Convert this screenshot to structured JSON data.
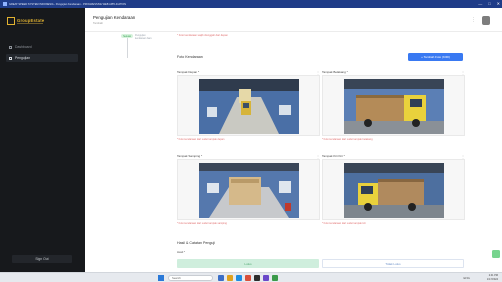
{
  "window": {
    "title": "GREAT SPEED SYSTEM INDONESIA - Pengujian Kendaraan - PROGRESSIVE WEB APPLICATION",
    "controls": [
      "—",
      "□",
      "✕"
    ]
  },
  "sidebar": {
    "logo_text": "GroupEstate",
    "items": [
      {
        "label": "Dashboard",
        "icon": "home-icon"
      },
      {
        "label": "Pengujian",
        "icon": "clipboard-icon"
      }
    ],
    "signout_label": "Sign Out"
  },
  "header": {
    "title": "Pengujian Kendaraan",
    "subtitle": "Tambah",
    "menu_glyph": "⋮"
  },
  "stepper": {
    "badge": "Selesai",
    "text": "Pengujian kendaraan baru"
  },
  "top_note": "* Foto kendaraan wajib diunggah dari depan",
  "photos_section": {
    "title": "Foto Kendaraan",
    "add_button": "+ Tambah Foto (KIRI)",
    "photos": [
      {
        "label": "Tampak Depan *",
        "note": "* Foto kendaraan dari sudut tampak depan"
      },
      {
        "label": "Tampak Belakang *",
        "note": "* Foto kendaraan dari sudut tampak belakang"
      },
      {
        "label": "Tampak Samping *",
        "note": "* Foto kendaraan dari sudut tampak samping"
      },
      {
        "label": "Tampak Kiri Kiri *",
        "note": "* Foto kendaraan dari sudut tampak kiri"
      }
    ],
    "remove_glyph": "⋮"
  },
  "result_section": {
    "title": "Hasil & Catatan Penguji",
    "result_label": "Hasil *",
    "pass_label": "Lulus",
    "fail_label": "Tidak Lulus"
  },
  "taskbar": {
    "search_placeholder": "Search",
    "time": "2:41 PM",
    "date": "1/17/2024",
    "tray_text": "ENG"
  },
  "colors": {
    "accent": "#3979f2",
    "sidebar": "#17191c",
    "logo": "#e2b230",
    "pass": "#cfeedd",
    "error_note": "#e07070"
  }
}
